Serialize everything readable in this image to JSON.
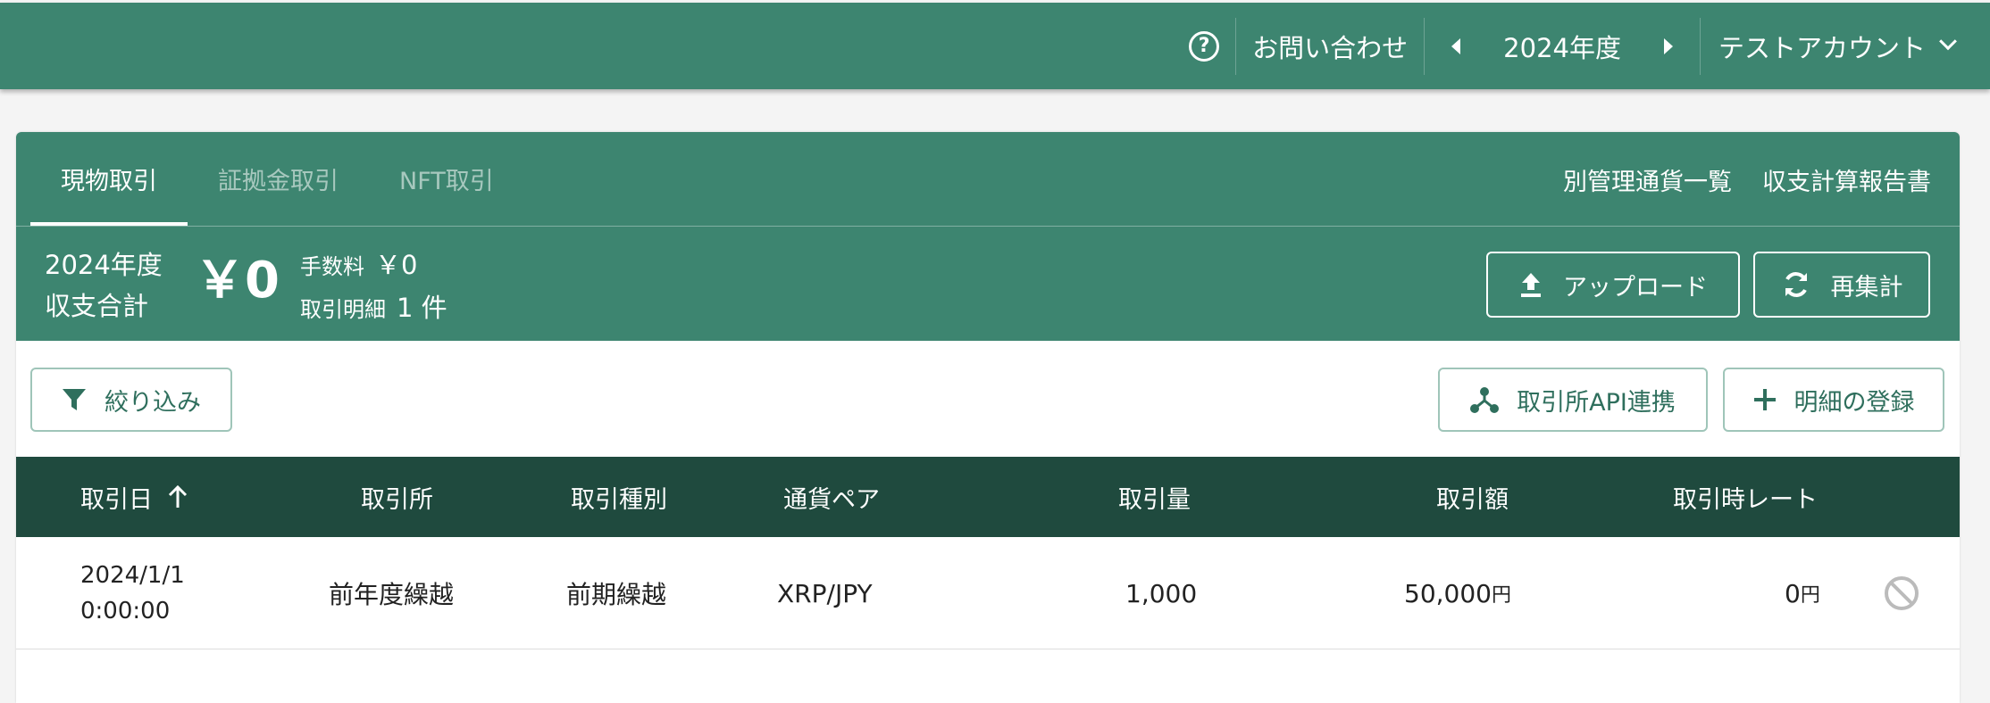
{
  "topbar": {
    "help_icon_glyph": "?",
    "contact_label": "お問い合わせ",
    "fiscal_year_label": "2024年度",
    "account_label": "テストアカウント"
  },
  "tabs": [
    {
      "label": "現物取引",
      "active": true
    },
    {
      "label": "証拠金取引",
      "active": false
    },
    {
      "label": "NFT取引",
      "active": false
    }
  ],
  "tab_links": {
    "separate_currency": "別管理通貨一覧",
    "income_report": "収支計算報告書"
  },
  "summary": {
    "year_line": "2024年度",
    "total_line": "収支合計",
    "total_amount": "￥0",
    "fee_label": "手数料",
    "fee_value": "￥0",
    "details_label": "取引明細",
    "details_value": "1 件",
    "upload_label": "アップロード",
    "recalc_label": "再集計"
  },
  "actions": {
    "filter_label": "絞り込み",
    "api_label": "取引所API連携",
    "add_label": "明細の登録"
  },
  "table": {
    "columns": [
      "取引日",
      "取引所",
      "取引種別",
      "通貨ペア",
      "取引量",
      "取引額",
      "取引時レート"
    ],
    "rows": [
      {
        "date": "2024/1/1",
        "time": "0:00:00",
        "exchange": "前年度繰越",
        "type": "前期繰越",
        "pair": "XRP/JPY",
        "amount": "1,000",
        "value": "50,000",
        "value_unit": "円",
        "rate": "0",
        "rate_unit": "円"
      }
    ]
  },
  "colors": {
    "primary": "#3d8570",
    "header_dark": "#1f4a3e",
    "outline": "#9fc5b9"
  }
}
